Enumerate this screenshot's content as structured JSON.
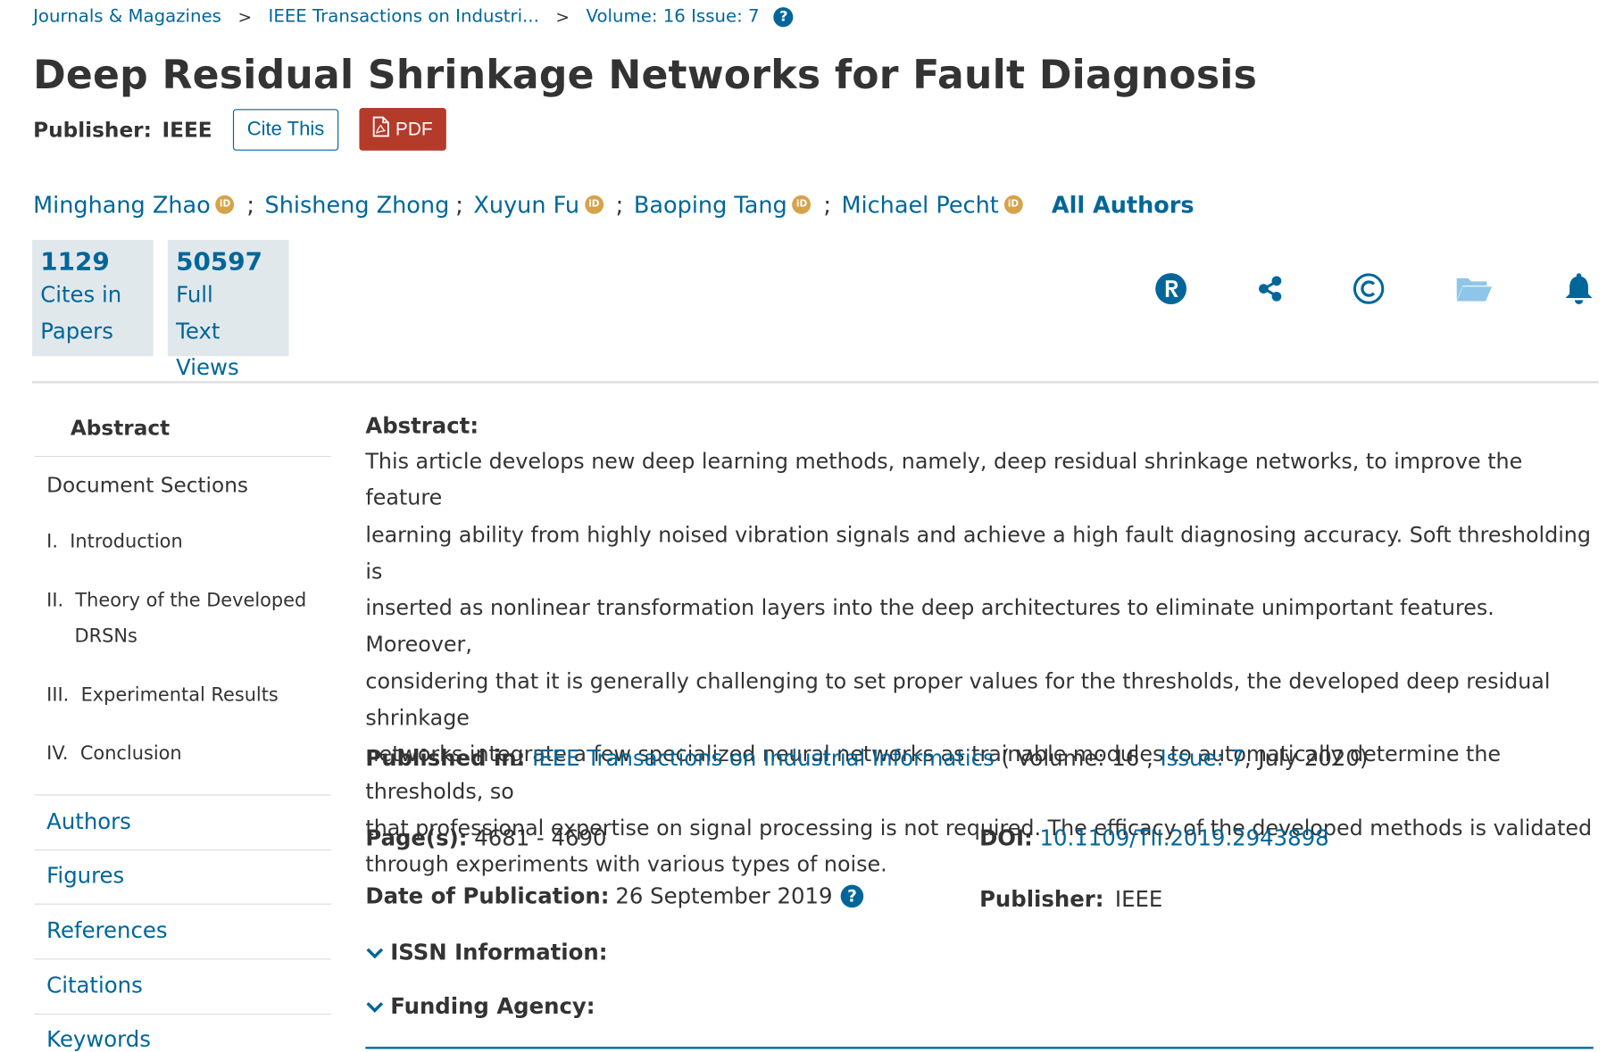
{
  "breadcrumb": {
    "items": [
      "Journals & Magazines",
      "IEEE Transactions on Industri...",
      "Volume: 16 Issue: 7"
    ],
    "separator": ">",
    "help": "?"
  },
  "title": "Deep Residual Shrinkage Networks for Fault Diagnosis",
  "publisher": {
    "label": "Publisher:",
    "value": "IEEE"
  },
  "buttons": {
    "cite": "Cite This",
    "pdf": "PDF"
  },
  "authors": {
    "list": [
      "Minghang Zhao",
      "Shisheng Zhong",
      "Xuyun Fu",
      "Baoping Tang",
      "Michael Pecht"
    ],
    "separator": ";",
    "orcid_text": "iD",
    "all_authors": "All Authors"
  },
  "metrics": [
    {
      "value": "1129",
      "line1": "Cites in",
      "line2": "Papers"
    },
    {
      "value": "50597",
      "line1": "Full",
      "line2": "Text Views"
    }
  ],
  "actions": [
    "rightslink-icon",
    "share-icon",
    "copyright-icon",
    "folder-icon",
    "bell-icon"
  ],
  "colors": {
    "link": "#006699",
    "pdf": "#b43a2a",
    "metric_bg": "#e1e8ec",
    "orcid": "#d6a24a",
    "folder": "#8ec6ea"
  },
  "sidebar": {
    "abstract": "Abstract",
    "document_sections": "Document Sections",
    "sections": [
      {
        "num": "I.",
        "label": "Introduction"
      },
      {
        "num": "II.",
        "label": "Theory of the Developed",
        "label2": "DRSNs"
      },
      {
        "num": "III.",
        "label": "Experimental Results"
      },
      {
        "num": "IV.",
        "label": "Conclusion"
      }
    ],
    "links": [
      "Authors",
      "Figures",
      "References",
      "Citations",
      "Keywords"
    ]
  },
  "abstract": {
    "heading": "Abstract:",
    "lines": [
      "This article develops new deep learning methods, namely, deep residual shrinkage networks, to improve the feature",
      "learning ability from highly noised vibration signals and achieve a high fault diagnosing accuracy. Soft thresholding is",
      "inserted as nonlinear transformation layers into the deep architectures to eliminate unimportant features. Moreover,",
      "considering that it is generally challenging to set proper values for the thresholds, the developed deep residual shrinkage",
      "networks integrate a few specialized neural networks as trainable modules to automatically determine the thresholds, so",
      "that professional expertise on signal processing is not required. The efficacy of the developed methods is validated",
      "through experiments with various types of noise."
    ]
  },
  "published_in": {
    "label": "Published in:",
    "journal": "IEEE Transactions on Industrial Informatics",
    "open": "( Volume: 16 ,",
    "issue": "Issue: 7",
    "close": ", July 2020)"
  },
  "details": {
    "pages_label": "Page(s):",
    "pages_value": "4681 - 4690",
    "doi_label": "DOI:",
    "doi_value": "10.1109/TII.2019.2943898",
    "date_label": "Date of Publication:",
    "date_value": "26 September 2019",
    "publisher_label": "Publisher:",
    "publisher_value": "IEEE"
  },
  "expanders": [
    "ISSN Information:",
    "Funding Agency:"
  ]
}
